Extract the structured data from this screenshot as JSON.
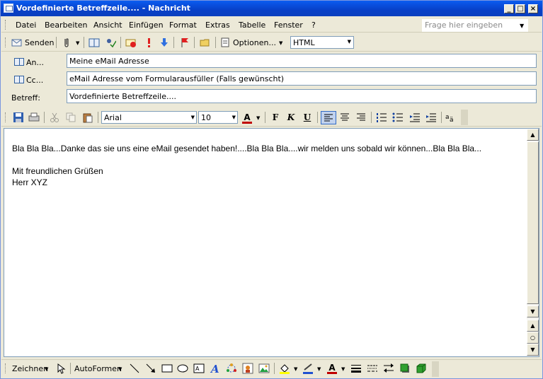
{
  "window": {
    "title": "Vordefinierte Betreffzeile.... - Nachricht",
    "min_label": "_",
    "max_label": "□",
    "close_label": "×"
  },
  "menu": {
    "items": [
      "Datei",
      "Bearbeiten",
      "Ansicht",
      "Einfügen",
      "Format",
      "Extras",
      "Tabelle",
      "Fenster",
      "?"
    ],
    "help_placeholder": "Frage hier eingeben"
  },
  "toolbar": {
    "send_label": "Senden",
    "options_label": "Optionen...",
    "format_value": "HTML"
  },
  "header": {
    "to_label": "An...",
    "to_value": "Meine eMail Adresse",
    "cc_label": "Cc...",
    "cc_value": "eMail Adresse vom Formularausfüller (Falls gewünscht)",
    "subject_label": "Betreff:",
    "subject_value": "Vordefinierte Betreffzeile...."
  },
  "formatting": {
    "font_value": "Arial",
    "size_value": "10",
    "bold_label": "F",
    "italic_label": "K",
    "underline_label": "U",
    "font_color_label": "A"
  },
  "message": {
    "line1": "Bla Bla Bla...Danke das sie uns eine eMail gesendet haben!....Bla Bla Bla....wir melden uns sobald wir können...Bla Bla Bla...",
    "line2": "Mit freundlichen Grüßen",
    "line3": "Herr XYZ"
  },
  "drawing": {
    "draw_label": "Zeichnen",
    "autoshapes_label": "AutoFormen",
    "font_color_label": "A"
  },
  "colors": {
    "titlebar": "#0a5cf0",
    "font_color_bar": "#c00000",
    "highlight": "#ffff00"
  }
}
